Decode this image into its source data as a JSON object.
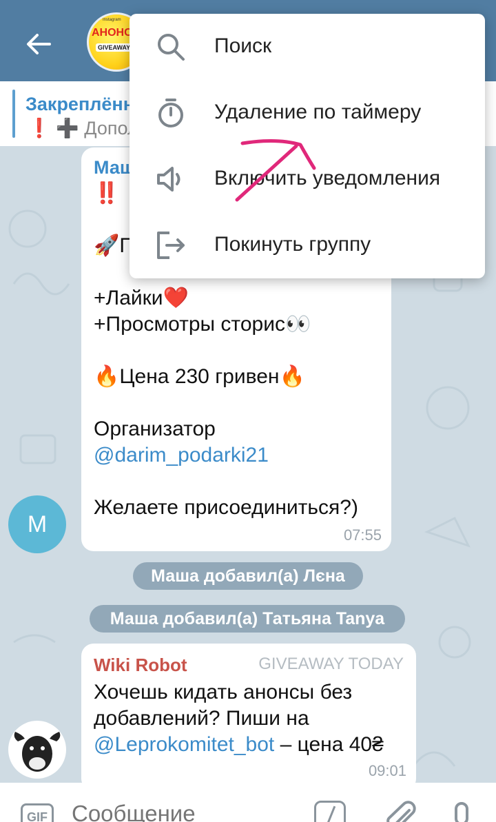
{
  "header": {
    "back_icon": "arrow-left-icon",
    "group_avatar": {
      "line1": "АНОНС",
      "line2": "GIVEAWAY",
      "brand": "Instagram"
    }
  },
  "pinned": {
    "title": "Закреплённ",
    "excl": "❗",
    "plus": "➕",
    "preview": "Допол"
  },
  "messages": [
    {
      "sender": "Маш",
      "lines": [
        "‼️",
        "",
        "🚀П",
        "",
        "+Лайки❤️",
        "+Просмотры сторис👀",
        "",
        "🔥Цена 230 гривен🔥",
        "",
        "Организатор"
      ],
      "link": "@darim_podarki21",
      "closing": "Желаете присоединиться?)",
      "time": "07:55",
      "avatar_letter": "M"
    }
  ],
  "service_messages": [
    "Маша добавил(а) Лєна",
    "Маша добавил(а) Татьяна Tanya"
  ],
  "bot_message": {
    "sender": "Wiki Robot",
    "badge": "GIVEAWAY TODAY",
    "line1": "Хочешь кидать анонсы без",
    "line2": "добавлений? Пиши на",
    "link": "@Leprokomitet_bot",
    "price": " – цена 40₴",
    "time": "09:01"
  },
  "composer": {
    "gif_label": "GIF",
    "placeholder": "Сообщение"
  },
  "menu": {
    "items": [
      {
        "label": "Поиск",
        "icon": "search-icon"
      },
      {
        "label": "Удаление по таймеру",
        "icon": "timer-icon"
      },
      {
        "label": "Включить уведомления",
        "icon": "speaker-icon"
      },
      {
        "label": "Покинуть группу",
        "icon": "exit-icon"
      }
    ]
  },
  "colors": {
    "header": "#517da2",
    "accent": "#3b8bc9",
    "annotation": "#e0287a"
  }
}
